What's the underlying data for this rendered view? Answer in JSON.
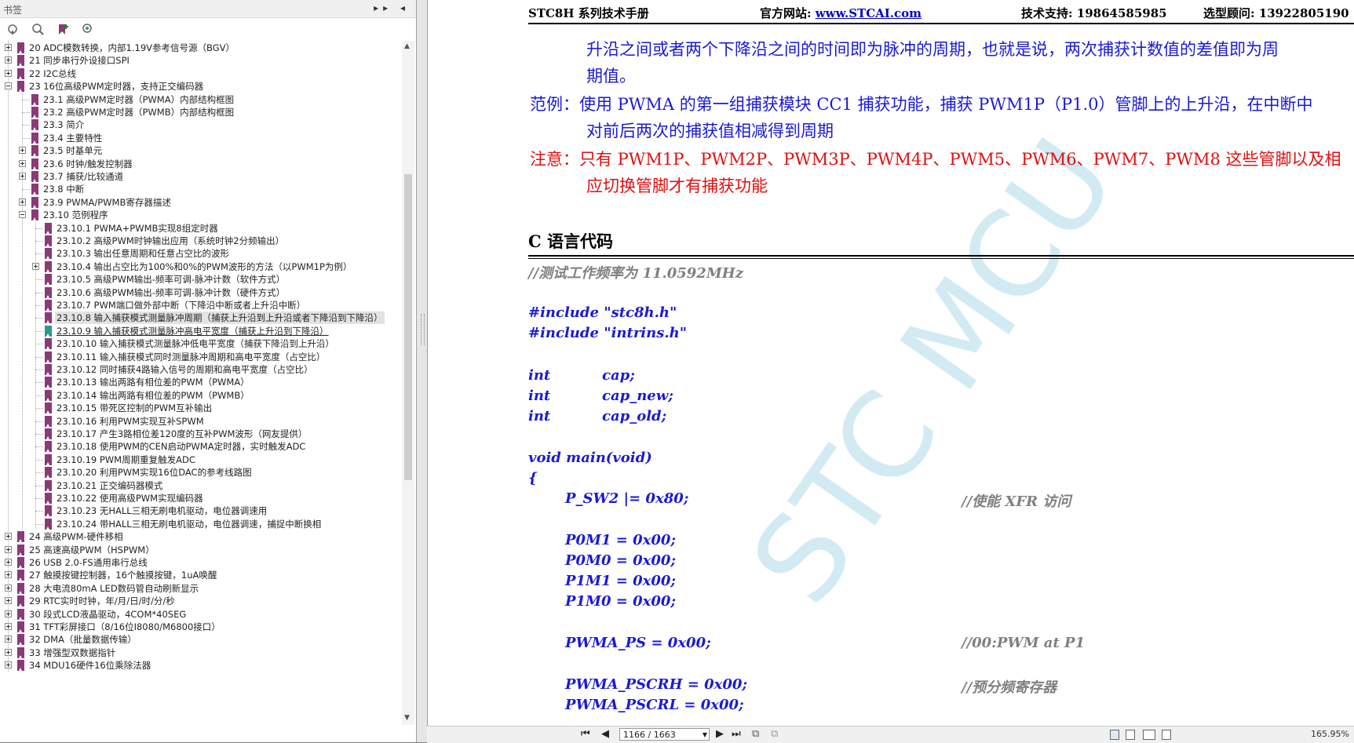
{
  "bookmarks": {
    "title": "书签",
    "header_buttons": "▸▸ ◂",
    "toolbar_icons": [
      "bookmark-options-icon",
      "expand-bookmark-icon",
      "new-bookmark-icon",
      "find-bookmark-icon"
    ],
    "items": [
      {
        "level": 0,
        "expand": "plus",
        "label": "20  ADC模数转换，内部1.19V参考信号源（BGV）"
      },
      {
        "level": 0,
        "expand": "plus",
        "label": "21  同步串行外设接口SPI"
      },
      {
        "level": 0,
        "expand": "plus",
        "label": "22  I2C总线"
      },
      {
        "level": 0,
        "expand": "minus",
        "label": "23  16位高级PWM定时器，支持正交编码器"
      },
      {
        "level": 1,
        "expand": "none",
        "label": "23.1  高级PWM定时器（PWMA）内部结构框图"
      },
      {
        "level": 1,
        "expand": "none",
        "label": "23.2  高级PWM定时器（PWMB）内部结构框图"
      },
      {
        "level": 1,
        "expand": "none",
        "label": "23.3  简介"
      },
      {
        "level": 1,
        "expand": "none",
        "label": "23.4  主要特性"
      },
      {
        "level": 1,
        "expand": "plus",
        "label": "23.5  时基单元"
      },
      {
        "level": 1,
        "expand": "plus",
        "label": "23.6  时钟/触发控制器"
      },
      {
        "level": 1,
        "expand": "plus",
        "label": "23.7  捕获/比较通道"
      },
      {
        "level": 1,
        "expand": "none",
        "label": "23.8  中断"
      },
      {
        "level": 1,
        "expand": "plus",
        "label": "23.9  PWMA/PWMB寄存器描述"
      },
      {
        "level": 1,
        "expand": "minus",
        "label": "23.10  范例程序"
      },
      {
        "level": 2,
        "expand": "none",
        "label": "23.10.1  PWMA+PWMB实现8组定时器"
      },
      {
        "level": 2,
        "expand": "none",
        "label": "23.10.2  高级PWM时钟输出应用（系统时钟2分频输出）"
      },
      {
        "level": 2,
        "expand": "none",
        "label": "23.10.3  输出任意周期和任意占空比的波形"
      },
      {
        "level": 2,
        "expand": "plus",
        "label": "23.10.4  输出占空比为100%和0%的PWM波形的方法（以PWM1P为例）"
      },
      {
        "level": 2,
        "expand": "none",
        "label": "23.10.5  高级PWM输出-频率可调-脉冲计数（软件方式）"
      },
      {
        "level": 2,
        "expand": "none",
        "label": "23.10.6  高级PWM输出-频率可调-脉冲计数（硬件方式）"
      },
      {
        "level": 2,
        "expand": "none",
        "label": "23.10.7  PWM端口做外部中断（下降沿中断或者上升沿中断）"
      },
      {
        "level": 2,
        "expand": "none",
        "label": "23.10.8  输入捕获模式测量脉冲周期（捕获上升沿到上升沿或者下降沿到下降沿）",
        "selected": true
      },
      {
        "level": 2,
        "expand": "none",
        "label": "23.10.9  输入捕获模式测量脉冲高电平宽度（捕获上升沿到下降沿）",
        "current": true
      },
      {
        "level": 2,
        "expand": "none",
        "label": "23.10.10  输入捕获模式测量脉冲低电平宽度（捕获下降沿到上升沿）"
      },
      {
        "level": 2,
        "expand": "none",
        "label": "23.10.11  输入捕获模式同时测量脉冲周期和高电平宽度（占空比）"
      },
      {
        "level": 2,
        "expand": "none",
        "label": "23.10.12  同时捕获4路输入信号的周期和高电平宽度（占空比）"
      },
      {
        "level": 2,
        "expand": "none",
        "label": "23.10.13  输出两路有相位差的PWM（PWMA）"
      },
      {
        "level": 2,
        "expand": "none",
        "label": "23.10.14  输出两路有相位差的PWM（PWMB）"
      },
      {
        "level": 2,
        "expand": "none",
        "label": "23.10.15  带死区控制的PWM互补输出"
      },
      {
        "level": 2,
        "expand": "none",
        "label": "23.10.16  利用PWM实现互补SPWM"
      },
      {
        "level": 2,
        "expand": "none",
        "label": "23.10.17  产生3路相位差120度的互补PWM波形（网友提供）"
      },
      {
        "level": 2,
        "expand": "none",
        "label": "23.10.18  使用PWM的CEN启动PWMA定时器，实时触发ADC"
      },
      {
        "level": 2,
        "expand": "none",
        "label": "23.10.19  PWM周期重复触发ADC"
      },
      {
        "level": 2,
        "expand": "none",
        "label": "23.10.20  利用PWM实现16位DAC的参考线路图"
      },
      {
        "level": 2,
        "expand": "none",
        "label": "23.10.21  正交编码器模式"
      },
      {
        "level": 2,
        "expand": "none",
        "label": "23.10.22  使用高级PWM实现编码器"
      },
      {
        "level": 2,
        "expand": "none",
        "label": "23.10.23  无HALL三相无刷电机驱动，电位器调速用"
      },
      {
        "level": 2,
        "expand": "none",
        "label": "23.10.24  带HALL三相无刷电机驱动，电位器调速，捕捉中断换相"
      },
      {
        "level": 0,
        "expand": "plus",
        "label": "24  高级PWM-硬件移相"
      },
      {
        "level": 0,
        "expand": "plus",
        "label": "25  高速高级PWM（HSPWM）"
      },
      {
        "level": 0,
        "expand": "plus",
        "label": "26  USB 2.0-FS通用串行总线"
      },
      {
        "level": 0,
        "expand": "plus",
        "label": "27  触摸按键控制器，16个触摸按键，1uA唤醒"
      },
      {
        "level": 0,
        "expand": "plus",
        "label": "28  大电流80mA  LED数码管自动刷新显示"
      },
      {
        "level": 0,
        "expand": "plus",
        "label": "29  RTC实时时钟，年/月/日/时/分/秒"
      },
      {
        "level": 0,
        "expand": "plus",
        "label": "30  段式LCD液晶驱动，4COM*40SEG"
      },
      {
        "level": 0,
        "expand": "plus",
        "label": "31  TFT彩屏接口（8/16位I8080/M6800接口）"
      },
      {
        "level": 0,
        "expand": "plus",
        "label": "32  DMA（批量数据传输）"
      },
      {
        "level": 0,
        "expand": "plus",
        "label": "33  增强型双数据指针"
      },
      {
        "level": 0,
        "expand": "plus",
        "label": "34  MDU16硬件16位乘除法器"
      }
    ]
  },
  "document": {
    "header": {
      "manual": "STC8H 系列技术手册",
      "website_label": "官方网站: ",
      "website": "www.STCAI.com",
      "support": "技术支持: 19864585985",
      "sales": "选型顾问: 13922805190"
    },
    "paragraphs": {
      "p1_line1": "升沿之间或者两个下降沿之间的时间即为脉冲的周期，也就是说，两次捕获计数值的差值即为周",
      "p1_line2": "期值。",
      "example_line1": "范例：使用 PWMA 的第一组捕获模块 CC1 捕获功能，捕获 PWM1P（P1.0）管脚上的上升沿，在中断中",
      "example_line2": "对前后两次的捕获值相减得到周期",
      "note_line1": "注意：只有 PWM1P、PWM2P、PWM3P、PWM4P、PWM5、PWM6、PWM7、PWM8 这些管脚以及相",
      "note_line2": "应切换管脚才有捕获功能"
    },
    "section_title": "C 语言代码",
    "code": {
      "c1": "//测试工作频率为 11.0592MHz",
      "inc1": "#include \"stc8h.h\"",
      "inc2": "#include \"intrins.h\"",
      "t1": "int",
      "v1": "cap;",
      "t2": "int",
      "v2": "cap_new;",
      "t3": "int",
      "v3": "cap_old;",
      "main": "void main(void)",
      "brace": "{",
      "s1": "P_SW2 |= 0x80;",
      "s1c": "//使能 XFR 访问",
      "s2": "P0M1 = 0x00;",
      "s3": "P0M0 = 0x00;",
      "s4": "P1M1 = 0x00;",
      "s5": "P1M0 = 0x00;",
      "s6": "PWMA_PS = 0x00;",
      "s6c": "//00:PWM at P1",
      "s7": "PWMA_PSCRH = 0x00;",
      "s7c": "//预分频寄存器",
      "s8": "PWMA_PSCRL = 0x00;"
    },
    "watermark": "STC MCU"
  },
  "statusbar": {
    "page_value": "1166 / 1663",
    "zoom": "165.95%"
  },
  "colors": {
    "blue_text": "#1a1ad6",
    "red_text": "#e01010",
    "bookmark_flag": "#8a3a78",
    "current_flag": "#2a9a8e"
  }
}
